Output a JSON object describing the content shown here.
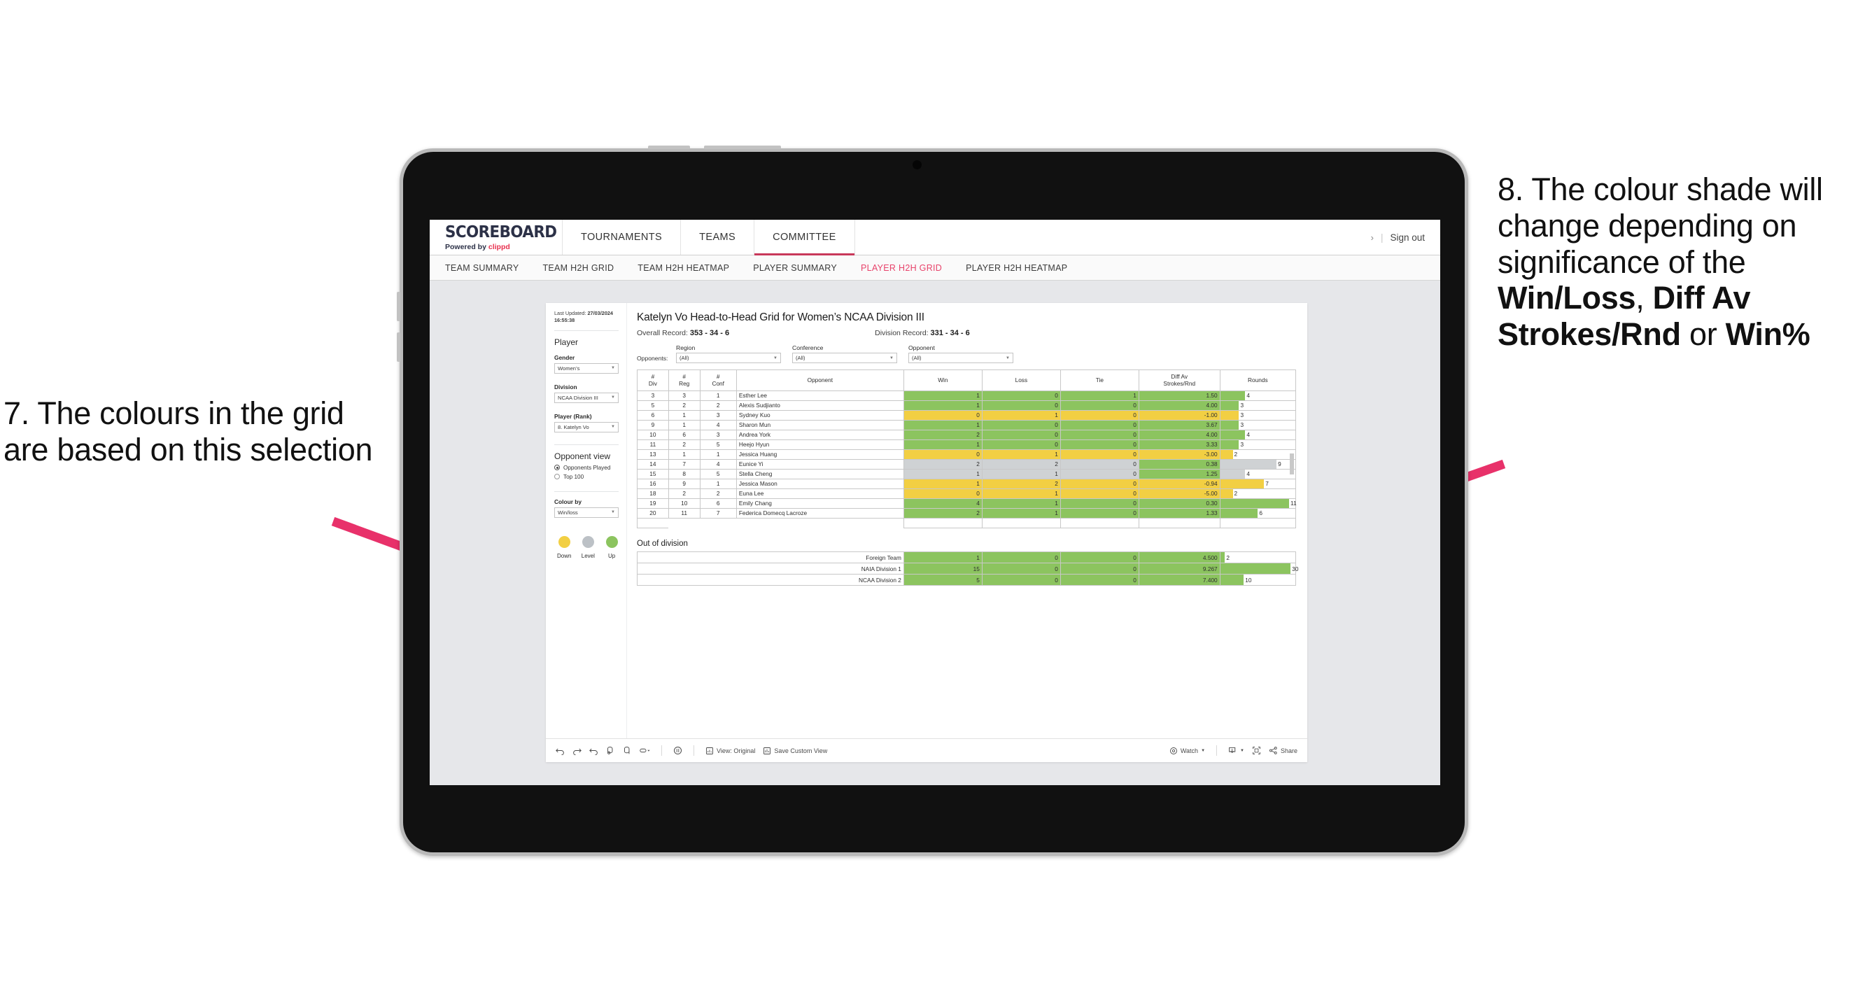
{
  "annotations": {
    "left": {
      "id": "7.",
      "text": "7. The colours in the grid are based on this selection"
    },
    "right": {
      "lead": "8. The colour shade will change depending on significance of the ",
      "bold1": "Win/Loss",
      "mid1": ", ",
      "bold2": "Diff Av Strokes/Rnd",
      "mid2": " or ",
      "bold3": "Win%"
    },
    "arrow_color": "#e8316a"
  },
  "topbar": {
    "brand_title": "SCOREBOARD",
    "brand_sub_prefix": "Powered by ",
    "brand_sub_brand": "clippd",
    "nav": [
      {
        "label": "TOURNAMENTS",
        "active": false
      },
      {
        "label": "TEAMS",
        "active": false
      },
      {
        "label": "COMMITTEE",
        "active": true
      }
    ],
    "chevron": "›",
    "divider": "|",
    "sign_out": "Sign out"
  },
  "subnav": [
    {
      "label": "TEAM SUMMARY",
      "active": false
    },
    {
      "label": "TEAM H2H GRID",
      "active": false
    },
    {
      "label": "TEAM H2H HEATMAP",
      "active": false
    },
    {
      "label": "PLAYER SUMMARY",
      "active": false
    },
    {
      "label": "PLAYER H2H GRID",
      "active": true
    },
    {
      "label": "PLAYER H2H HEATMAP",
      "active": false
    }
  ],
  "sidebar": {
    "last_updated_label": "Last Updated:",
    "last_updated_date": "27/03/2024",
    "last_updated_time": "16:55:38",
    "player_heading": "Player",
    "gender_label": "Gender",
    "gender_value": "Women’s",
    "division_label": "Division",
    "division_value": "NCAA Division III",
    "player_rank_label": "Player (Rank)",
    "player_rank_value": "8. Katelyn Vo",
    "opponent_view_heading": "Opponent view",
    "opponent_view_options": [
      {
        "label": "Opponents Played",
        "selected": true
      },
      {
        "label": "Top 100",
        "selected": false
      }
    ],
    "colour_by_label": "Colour by",
    "colour_by_value": "Win/loss",
    "legend": [
      {
        "label": "Down",
        "color": "#f2cf43"
      },
      {
        "label": "Level",
        "color": "#bcc1c6"
      },
      {
        "label": "Up",
        "color": "#8cc45f"
      }
    ]
  },
  "main": {
    "title": "Katelyn Vo Head-to-Head Grid for Women’s NCAA Division III",
    "overall_record_label": "Overall Record:",
    "overall_record_value": "353 -  34 - 6",
    "division_record_label": "Division Record:",
    "division_record_value": "331 -  34 - 6",
    "opponents_label": "Opponents:",
    "filters": [
      {
        "label": "Region",
        "value": "(All)"
      },
      {
        "label": "Conference",
        "value": "(All)"
      },
      {
        "label": "Opponent",
        "value": "(All)"
      }
    ],
    "out_of_division_title": "Out of division"
  },
  "chart_data": {
    "type": "table",
    "title": "Katelyn Vo Head-to-Head Grid for Women’s NCAA Division III",
    "columns": [
      {
        "key": "div",
        "header_line1": "#",
        "header_line2": "Div"
      },
      {
        "key": "reg",
        "header_line1": "#",
        "header_line2": "Reg"
      },
      {
        "key": "conf",
        "header_line1": "#",
        "header_line2": "Conf"
      },
      {
        "key": "opponent",
        "header_line1": "Opponent",
        "header_line2": ""
      },
      {
        "key": "win",
        "header_line1": "Win",
        "header_line2": ""
      },
      {
        "key": "loss",
        "header_line1": "Loss",
        "header_line2": ""
      },
      {
        "key": "tie",
        "header_line1": "Tie",
        "header_line2": ""
      },
      {
        "key": "diff",
        "header_line1": "Diff Av",
        "header_line2": "Strokes/Rnd"
      },
      {
        "key": "rounds",
        "header_line1": "Rounds",
        "header_line2": ""
      }
    ],
    "colour_scale": {
      "up": "#8cc45f",
      "down": "#f2cf43",
      "level": "#cfd2d4"
    },
    "rows": [
      {
        "div": "3",
        "reg": "3",
        "conf": "1",
        "opponent": "Esther Lee",
        "win": "1",
        "loss": "0",
        "tie": "1",
        "diff": "1.50",
        "rounds": 4,
        "state": "up"
      },
      {
        "div": "5",
        "reg": "2",
        "conf": "2",
        "opponent": "Alexis Sudjianto",
        "win": "1",
        "loss": "0",
        "tie": "0",
        "diff": "4.00",
        "rounds": 3,
        "state": "up"
      },
      {
        "div": "6",
        "reg": "1",
        "conf": "3",
        "opponent": "Sydney Kuo",
        "win": "0",
        "loss": "1",
        "tie": "0",
        "diff": "-1.00",
        "rounds": 3,
        "state": "down"
      },
      {
        "div": "9",
        "reg": "1",
        "conf": "4",
        "opponent": "Sharon Mun",
        "win": "1",
        "loss": "0",
        "tie": "0",
        "diff": "3.67",
        "rounds": 3,
        "state": "up"
      },
      {
        "div": "10",
        "reg": "6",
        "conf": "3",
        "opponent": "Andrea York",
        "win": "2",
        "loss": "0",
        "tie": "0",
        "diff": "4.00",
        "rounds": 4,
        "state": "up"
      },
      {
        "div": "11",
        "reg": "2",
        "conf": "5",
        "opponent": "Heejo Hyun",
        "win": "1",
        "loss": "0",
        "tie": "0",
        "diff": "3.33",
        "rounds": 3,
        "state": "up"
      },
      {
        "div": "13",
        "reg": "1",
        "conf": "1",
        "opponent": "Jessica Huang",
        "win": "0",
        "loss": "1",
        "tie": "0",
        "diff": "-3.00",
        "rounds": 2,
        "state": "down"
      },
      {
        "div": "14",
        "reg": "7",
        "conf": "4",
        "opponent": "Eunice Yi",
        "win": "2",
        "loss": "2",
        "tie": "0",
        "diff": "0.38",
        "rounds": 9,
        "state": "level",
        "diff_state": "up"
      },
      {
        "div": "15",
        "reg": "8",
        "conf": "5",
        "opponent": "Stella Cheng",
        "win": "1",
        "loss": "1",
        "tie": "0",
        "diff": "1.25",
        "rounds": 4,
        "state": "level",
        "diff_state": "up"
      },
      {
        "div": "16",
        "reg": "9",
        "conf": "1",
        "opponent": "Jessica Mason",
        "win": "1",
        "loss": "2",
        "tie": "0",
        "diff": "-0.94",
        "rounds": 7,
        "state": "down"
      },
      {
        "div": "18",
        "reg": "2",
        "conf": "2",
        "opponent": "Euna Lee",
        "win": "0",
        "loss": "1",
        "tie": "0",
        "diff": "-5.00",
        "rounds": 2,
        "state": "down"
      },
      {
        "div": "19",
        "reg": "10",
        "conf": "6",
        "opponent": "Emily Chang",
        "win": "4",
        "loss": "1",
        "tie": "0",
        "diff": "0.30",
        "rounds": 11,
        "state": "up"
      },
      {
        "div": "20",
        "reg": "11",
        "conf": "7",
        "opponent": "Federica Domecq Lacroze",
        "win": "2",
        "loss": "1",
        "tie": "0",
        "diff": "1.33",
        "rounds": 6,
        "state": "up"
      }
    ],
    "rounds_max": 12,
    "out_of_division": {
      "title": "Out of division",
      "rounds_max": 32,
      "rows": [
        {
          "name": "Foreign Team",
          "win": "1",
          "loss": "0",
          "tie": "0",
          "diff": "4.500",
          "rounds": 2,
          "state": "up"
        },
        {
          "name": "NAIA Division 1",
          "win": "15",
          "loss": "0",
          "tie": "0",
          "diff": "9.267",
          "rounds": 30,
          "state": "up"
        },
        {
          "name": "NCAA Division 2",
          "win": "5",
          "loss": "0",
          "tie": "0",
          "diff": "7.400",
          "rounds": 10,
          "state": "up"
        }
      ]
    }
  },
  "toolbar": {
    "view_label": "View: Original",
    "save_label": "Save Custom View",
    "watch_label": "Watch",
    "share_label": "Share"
  }
}
